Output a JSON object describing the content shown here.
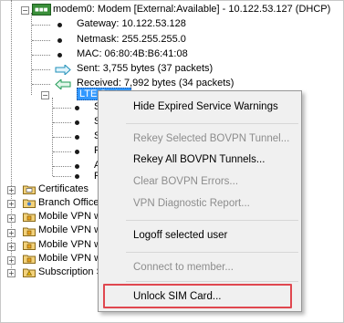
{
  "tree": {
    "modem": "modem0: Modem [External:Available] - 10.122.53.127 (DHCP)",
    "gateway": "Gateway: 10.122.53.128",
    "netmask": "Netmask: 255.255.255.0",
    "mac": "MAC: 06:80:4B:B6:41:08",
    "sent": "Sent: 3,755 bytes (37 packets)",
    "received": "Received: 7,992 bytes (34 packets)",
    "lte_status": "LTE Status",
    "lte_children": [
      "S",
      "S",
      "S",
      "P",
      "A",
      "F"
    ],
    "certificates": "Certificates",
    "branch_office": "Branch Office",
    "mobile_vpn": [
      "Mobile VPN w",
      "Mobile VPN w",
      "Mobile VPN w",
      "Mobile VPN w"
    ],
    "subscription": "Subscription S"
  },
  "context_menu": {
    "items": [
      {
        "label": "Hide Expired Service Warnings",
        "enabled": true
      },
      {
        "label": "Rekey Selected BOVPN Tunnel...",
        "enabled": false
      },
      {
        "label": "Rekey All BOVPN Tunnels...",
        "enabled": true
      },
      {
        "label": "Clear BOVPN Errors...",
        "enabled": false
      },
      {
        "label": "VPN Diagnostic Report...",
        "enabled": false
      },
      {
        "label": "Logoff selected user",
        "enabled": true
      },
      {
        "label": "Connect to member...",
        "enabled": false
      },
      {
        "label": "Unlock SIM Card...",
        "enabled": true
      }
    ]
  },
  "colors": {
    "selection": "#3399ff",
    "highlight_box": "#e0474f",
    "arrow_sent": "#1f8fb8",
    "arrow_received": "#1f9a55"
  }
}
